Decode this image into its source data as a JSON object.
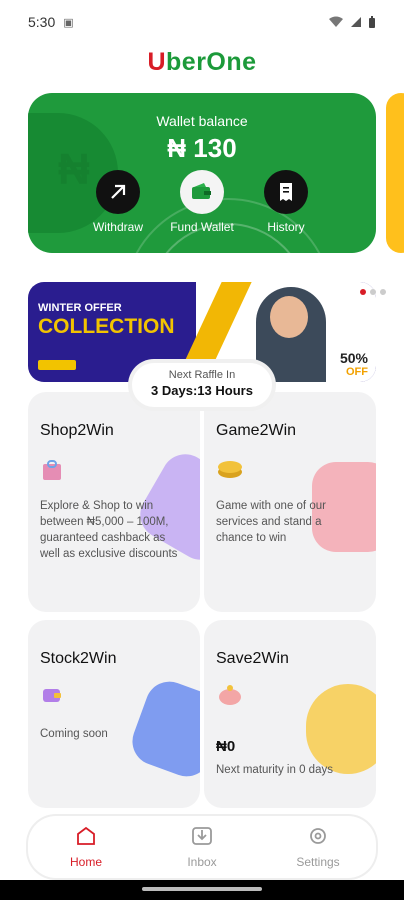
{
  "status_bar": {
    "time": "5:30"
  },
  "app": {
    "logo_letter": "U",
    "logo_rest": "berOne"
  },
  "wallet": {
    "label": "Wallet balance",
    "amount": "₦ 130",
    "bg_symbol": "₦",
    "actions": [
      {
        "label": "Withdraw",
        "icon": "arrow-up-right-icon"
      },
      {
        "label": "Fund Wallet",
        "icon": "wallet-icon"
      },
      {
        "label": "History",
        "icon": "receipt-icon"
      }
    ]
  },
  "banner": {
    "line1": "WINTER OFFER",
    "line2": "COLLECTION",
    "percent": "50%",
    "off": "OFF",
    "slides": 3,
    "active_slide": 0
  },
  "raffle": {
    "label": "Next Raffle In",
    "countdown": "3 Days:13 Hours"
  },
  "tiles": [
    {
      "title": "Shop2Win",
      "icon": "shopping-bag-icon",
      "description": "Explore & Shop to win between ₦5,000 – 100M, guaranteed cashback as well as exclusive discounts",
      "value": ""
    },
    {
      "title": "Game2Win",
      "icon": "coin-icon",
      "description": "Game with one of our services and stand a chance to win",
      "value": ""
    },
    {
      "title": "Stock2Win",
      "icon": "wallet-purple-icon",
      "description": "Coming soon",
      "value": ""
    },
    {
      "title": "Save2Win",
      "icon": "piggy-bank-icon",
      "description": "Next maturity in 0 days",
      "value": "₦0"
    }
  ],
  "tabs": [
    {
      "label": "Home",
      "icon": "home-icon",
      "active": true
    },
    {
      "label": "Inbox",
      "icon": "inbox-icon",
      "active": false
    },
    {
      "label": "Settings",
      "icon": "settings-icon",
      "active": false
    }
  ],
  "colors": {
    "brand_green": "#1f9a3c",
    "brand_red": "#d81d27",
    "accent_yellow": "#ffc01c"
  }
}
